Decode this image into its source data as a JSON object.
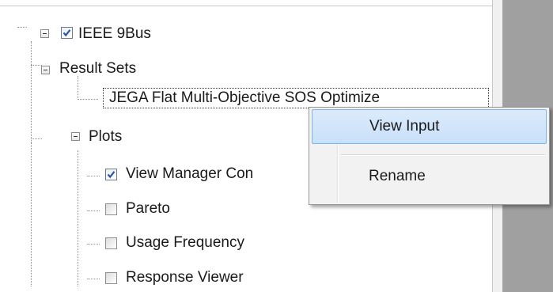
{
  "tree": {
    "root": {
      "label": "IEEE 9Bus",
      "checked": true
    },
    "result_sets": {
      "label": "Result Sets"
    },
    "result_item": {
      "label": "JEGA Flat Multi-Objective SOS Optimize"
    },
    "plots": {
      "label": "Plots"
    },
    "plot_items": [
      {
        "label": "View Manager Con",
        "checked": true
      },
      {
        "label": "Pareto",
        "checked": false
      },
      {
        "label": "Usage Frequency",
        "checked": false
      },
      {
        "label": "Response Viewer",
        "checked": false
      }
    ]
  },
  "context_menu": {
    "items": [
      {
        "label": "View Input",
        "highlighted": true
      },
      {
        "label": "Rename",
        "highlighted": false
      }
    ]
  },
  "colors": {
    "menu_highlight": "#c8e0fa",
    "menu_highlight_border": "#7eb4ea",
    "check_mark": "#2b56a8",
    "gray_area": "#a0a0a0"
  }
}
